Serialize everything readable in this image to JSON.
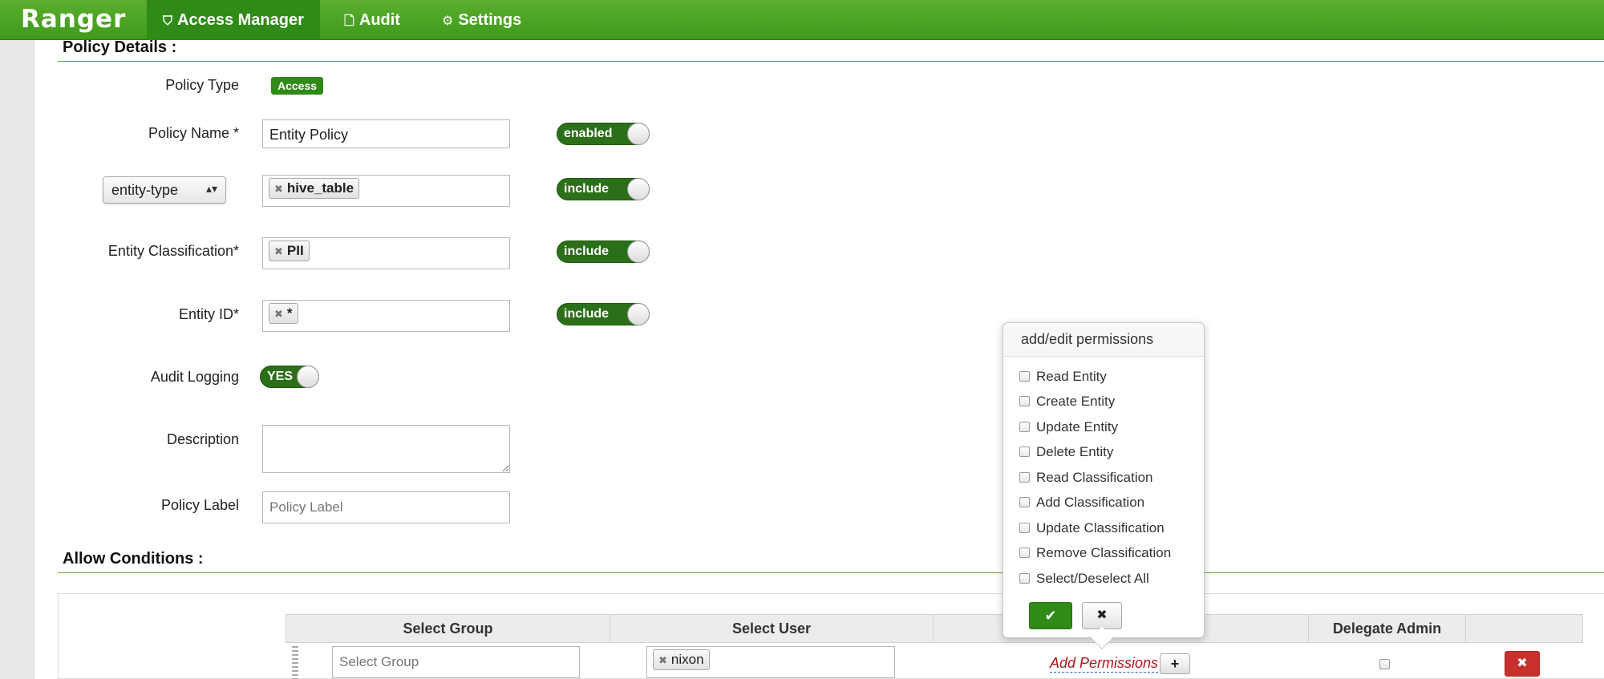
{
  "nav": {
    "brand": "Ranger",
    "items": [
      {
        "label": "Access Manager",
        "icon": "shield-icon",
        "active": true
      },
      {
        "label": "Audit",
        "icon": "file-icon",
        "active": false
      },
      {
        "label": "Settings",
        "icon": "gear-icon",
        "active": false
      }
    ],
    "colors": {
      "bar": "#4da426",
      "active": "#2f8a17"
    }
  },
  "policy": {
    "section_title": "Policy Details :",
    "policy_type_label": "Policy Type",
    "policy_type_value": "Access",
    "policy_name_label": "Policy Name *",
    "policy_name_value": "Entity  Policy",
    "policy_toggle": "enabled",
    "entity_type_select": "entity-type",
    "entity_type_tag": "hive_table",
    "entity_type_toggle": "include",
    "classification_label": "Entity Classification*",
    "classification_tag": "PII",
    "classification_toggle": "include",
    "entity_id_label": "Entity ID*",
    "entity_id_tag": "*",
    "entity_id_toggle": "include",
    "audit_label": "Audit Logging",
    "audit_toggle": "YES",
    "description_label": "Description",
    "description_value": "",
    "label_label": "Policy Label",
    "label_placeholder": "Policy Label"
  },
  "allow": {
    "section_title": "Allow Conditions :",
    "columns": [
      "Select Group",
      "Select User",
      "",
      "Delegate Admin"
    ],
    "group_placeholder": "Select Group",
    "user_tag": "nixon",
    "add_permissions": "Add Permissions",
    "delegate_admin_checked": false
  },
  "popover": {
    "title": "add/edit permissions",
    "options": [
      {
        "label": "Read Entity",
        "checked": false
      },
      {
        "label": "Create Entity",
        "checked": false
      },
      {
        "label": "Update Entity",
        "checked": false
      },
      {
        "label": "Delete Entity",
        "checked": false
      },
      {
        "label": "Read Classification",
        "checked": false
      },
      {
        "label": "Add Classification",
        "checked": false
      },
      {
        "label": "Update Classification",
        "checked": false
      },
      {
        "label": "Remove Classification",
        "checked": false
      },
      {
        "label": "Select/Deselect All",
        "checked": false
      }
    ]
  }
}
